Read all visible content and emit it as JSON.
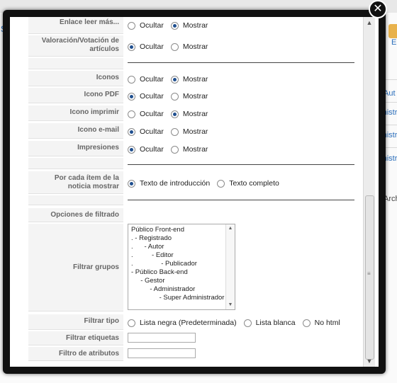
{
  "background": {
    "left_letter": "s",
    "right_toolbar_letters": [
      "e",
      "E"
    ],
    "column_header": "Aut",
    "column_cells": [
      "ministr",
      "ministr",
      "ministr"
    ],
    "archive_text": "Arch"
  },
  "modal": {
    "close_glyph": "✕",
    "rows": {
      "enlace": {
        "label": "Enlace leer más...",
        "opt1": "Ocultar",
        "opt2": "Mostrar"
      },
      "valoracion": {
        "label1": "Valoración/Votación de",
        "label2": "artículos",
        "opt1": "Ocultar",
        "opt2": "Mostrar"
      },
      "iconos": {
        "label": "Iconos",
        "opt1": "Ocultar",
        "opt2": "Mostrar"
      },
      "icono_pdf": {
        "label": "Icono PDF",
        "opt1": "Ocultar",
        "opt2": "Mostrar"
      },
      "icono_imprimir": {
        "label": "Icono imprimir",
        "opt1": "Ocultar",
        "opt2": "Mostrar"
      },
      "icono_email": {
        "label": "Icono e-mail",
        "opt1": "Ocultar",
        "opt2": "Mostrar"
      },
      "impresiones": {
        "label": "Impresiones",
        "opt1": "Ocultar",
        "opt2": "Mostrar"
      },
      "por_cada": {
        "label1": "Por cada ítem de la",
        "label2": "noticia mostrar",
        "opt1": "Texto de introducción",
        "opt2": "Texto completo"
      },
      "opciones_filtrado": {
        "label": "Opciones de filtrado"
      },
      "filtrar_grupos": {
        "label": "Filtrar grupos",
        "items": [
          "Público Front-end",
          ". - Registrado",
          ".      - Autor",
          ".          - Editor",
          ".               - Publicador",
          "- Público Back-end",
          "     - Gestor",
          "          - Administrador",
          "               - Super Administrador"
        ]
      },
      "filtrar_tipo": {
        "label": "Filtrar tipo",
        "opt1": "Lista negra (Predeterminada)",
        "opt2": "Lista blanca",
        "opt3": "No html"
      },
      "filtrar_etiquetas": {
        "label": "Filtrar etiquetas",
        "value": ""
      },
      "filtro_atributos": {
        "label": "Filtro de atributos",
        "value": ""
      }
    }
  }
}
